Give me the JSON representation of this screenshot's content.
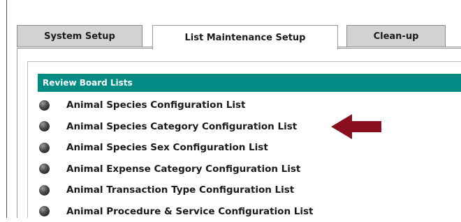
{
  "tabs": [
    {
      "label": "System Setup",
      "active": false
    },
    {
      "label": "List Maintenance Setup",
      "active": true
    },
    {
      "label": "Clean-up",
      "active": false
    }
  ],
  "section": {
    "title": "Review Board Lists"
  },
  "list_items": [
    {
      "label": "Animal Species Configuration List"
    },
    {
      "label": "Animal Species Category Configuration List"
    },
    {
      "label": "Animal Species Sex Configuration List"
    },
    {
      "label": "Animal Expense Category Configuration List"
    },
    {
      "label": "Animal Transaction Type Configuration List"
    },
    {
      "label": "Animal Procedure & Service Configuration List"
    }
  ],
  "annotation": {
    "arrow_icon": "left-arrow-icon",
    "arrow_color": "#8b0e1e",
    "points_to_item_index": 1
  },
  "colors": {
    "section_header": "#008c84",
    "inactive_tab": "#d2d2d2",
    "left_rule": "#1f5f93"
  }
}
